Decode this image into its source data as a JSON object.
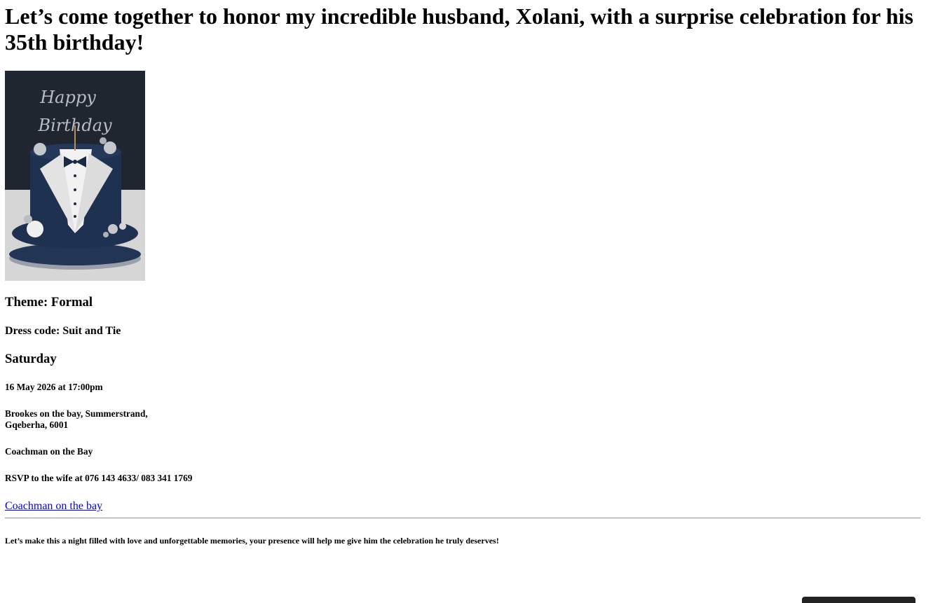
{
  "heading": "Let’s come together to honor my incredible husband, Xolani, with a surprise celebration for his 35th birthday!",
  "image": {
    "topper_line1": "Happy",
    "topper_line2": "Birthday",
    "colors": {
      "background": "#1c2129",
      "cake": "#1f3150",
      "lapel": "#e9e9e9",
      "table": "#d9d9d9"
    }
  },
  "theme": "Theme: Formal",
  "dress_code": "Dress code: Suit and Tie",
  "day": "Saturday",
  "date_time": "16 May 2026 at 17:00pm",
  "address_line1": "Brookes on the bay, Summerstrand,",
  "address_line2": "Gqeberha, 6001",
  "venue_name": "Coachman on the Bay",
  "rsvp": "RSVP to the wife at 076 143 4633/ 083 341 1769",
  "venue_link": "Coachman on the bay",
  "closing": "Let’s make this a night filled with love and unforgettable memories, your presence will help me give him the celebration he truly deserves!"
}
